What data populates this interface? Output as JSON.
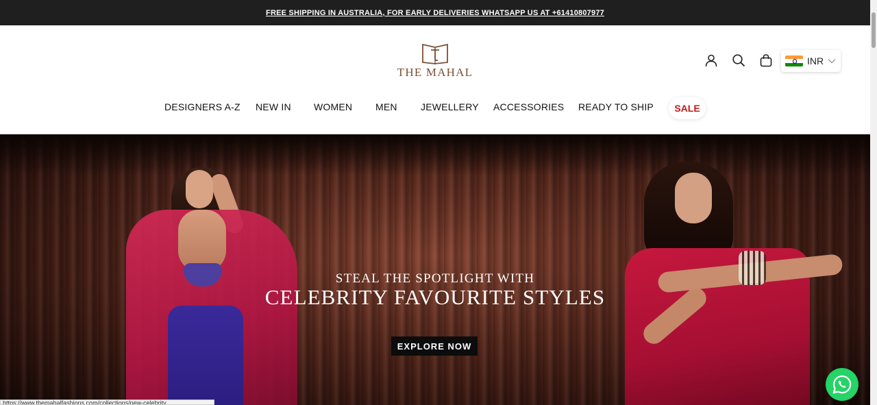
{
  "announcement": {
    "text": "FREE SHIPPING IN AUSTRALIA, FOR EARLY DELIVERIES WHATSAPP US AT +61410807977"
  },
  "header": {
    "logo_text": "THE MAHAL",
    "icons": [
      "account-icon",
      "search-icon",
      "cart-icon"
    ],
    "currency": {
      "code": "INR",
      "flag": "india-flag-icon"
    }
  },
  "nav": {
    "items": [
      {
        "label": "DESIGNERS A-Z"
      },
      {
        "label": "NEW IN"
      },
      {
        "label": "WOMEN"
      },
      {
        "label": "MEN"
      },
      {
        "label": "JEWELLERY"
      },
      {
        "label": "ACCESSORIES"
      },
      {
        "label": "READY TO SHIP"
      }
    ],
    "sale_label": "SALE",
    "sale_color": "#c21a1a"
  },
  "hero": {
    "line1": "STEAL THE SPOTLIGHT WITH",
    "line2": "CELEBRITY FAVOURITE STYLES",
    "cta_label": "EXPLORE NOW"
  },
  "status_bar": {
    "url": "https://www.themahalfashions.com/collections/new-celebrity..."
  },
  "colors": {
    "brand": "#7a4f35",
    "announce_bg": "#1f1f1f",
    "whatsapp": "#25d366"
  }
}
